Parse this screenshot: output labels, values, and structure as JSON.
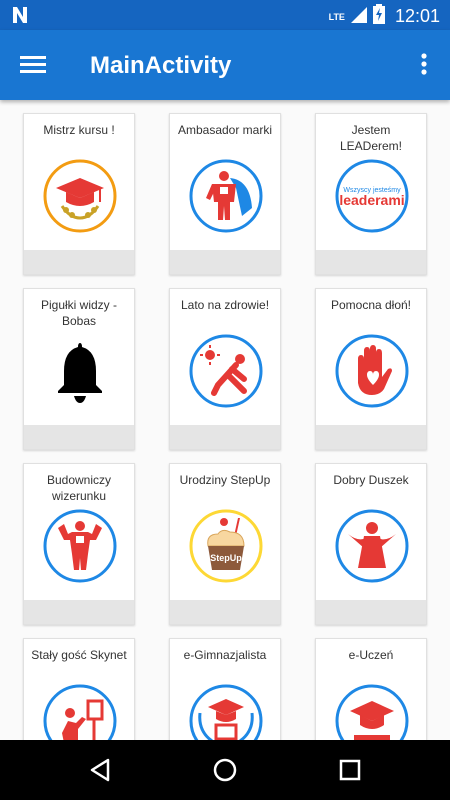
{
  "status_bar": {
    "time": "12:01",
    "network": "LTE"
  },
  "app_bar": {
    "title": "MainActivity"
  },
  "badges": [
    {
      "title": "Mistrz kursu !",
      "ring": "#f39c12",
      "icon": "graduation-cap-laurel-icon"
    },
    {
      "title": "Ambasador marki",
      "ring": "#1e88e5",
      "icon": "superhero-icon"
    },
    {
      "title": "Jestem LEADerem!",
      "ring": "#1e88e5",
      "icon": "leaderami-logo",
      "logo_line1": "Wszyscy jesteśmy",
      "logo_line2": "leaderami"
    },
    {
      "title": "Pigułki widzy - Bobas",
      "ring": "none",
      "icon": "bell-icon"
    },
    {
      "title": "Lato na zdrowie!",
      "ring": "#1e88e5",
      "icon": "sun-exercise-icon"
    },
    {
      "title": "Pomocna dłoń!",
      "ring": "#1e88e5",
      "icon": "helping-hand-icon"
    },
    {
      "title": "Budowniczy wizerunku",
      "ring": "#1e88e5",
      "icon": "strongman-icon"
    },
    {
      "title": "Urodziny StepUp",
      "ring": "#fdd835",
      "icon": "cupcake-icon",
      "logo_text": "StepUp"
    },
    {
      "title": "Dobry Duszek",
      "ring": "#1e88e5",
      "icon": "angel-icon"
    },
    {
      "title": "Stały gość Skynet",
      "ring": "#1e88e5",
      "icon": "skynet-guest-icon"
    },
    {
      "title": "e-Gimnazjalista",
      "ring": "#1e88e5",
      "icon": "gimnazjum-laurel-icon"
    },
    {
      "title": "e-Uczeń",
      "ring": "#1e88e5",
      "icon": "student-cap-icon"
    }
  ],
  "colors": {
    "primary": "#1976d2",
    "primary_dark": "#1565c0",
    "badge_red": "#e53935"
  }
}
